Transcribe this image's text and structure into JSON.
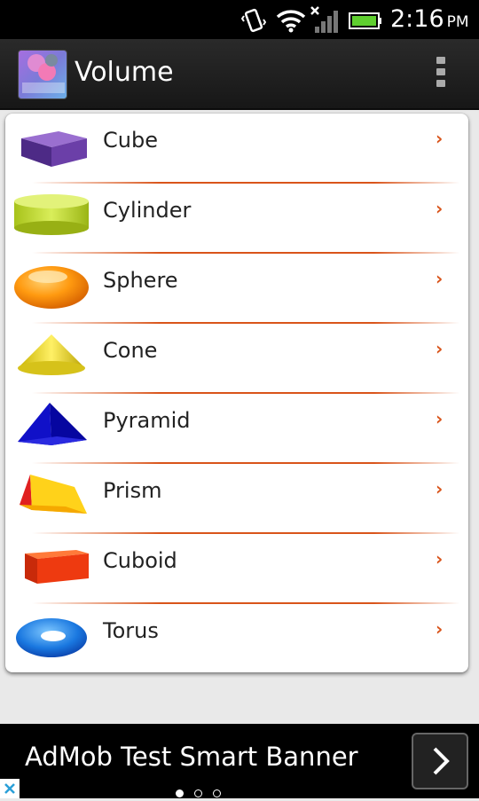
{
  "status_bar": {
    "time": "2:16",
    "ampm": "PM",
    "icons": [
      "vibrate-icon",
      "wifi-icon",
      "signal-icon",
      "battery-icon"
    ]
  },
  "action_bar": {
    "title": "Volume",
    "app_icon_name": "app-logo-icon",
    "menu_icon_name": "overflow-menu-icon"
  },
  "list": {
    "chevron": "›",
    "accent_color": "#d9541a",
    "items": [
      {
        "label": "Cube",
        "icon": "cube-icon"
      },
      {
        "label": "Cylinder",
        "icon": "cylinder-icon"
      },
      {
        "label": "Sphere",
        "icon": "sphere-icon"
      },
      {
        "label": "Cone",
        "icon": "cone-icon"
      },
      {
        "label": "Pyramid",
        "icon": "pyramid-icon"
      },
      {
        "label": "Prism",
        "icon": "prism-icon"
      },
      {
        "label": "Cuboid",
        "icon": "cuboid-icon"
      },
      {
        "label": "Torus",
        "icon": "torus-icon"
      }
    ]
  },
  "ad_banner": {
    "text": "AdMob Test Smart Banner",
    "button_icon": "chevron-right-icon",
    "page_dots": 3,
    "active_dot": 0
  }
}
